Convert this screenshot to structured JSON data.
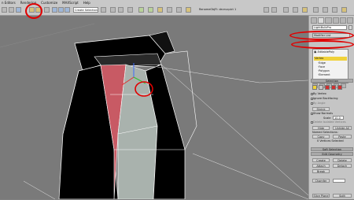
{
  "menu": {
    "items": [
      "n Editors",
      "Rendering",
      "Customize",
      "MAXScript",
      "Help"
    ]
  },
  "toolbar": {
    "selection_set": "Create Selection Set",
    "rename": "RenameObjFi: devrucpict 1"
  },
  "command_panel": {
    "object_name": "LightBulbPro",
    "modifier_list": "Modifier List",
    "stack": {
      "items": [
        {
          "label": "EditablePoly",
          "prefix": "▣-"
        },
        {
          "label": "Vertex",
          "prefix": "·"
        },
        {
          "label": "Edge",
          "prefix": "·"
        },
        {
          "label": "Face",
          "prefix": "·"
        },
        {
          "label": "Polygon",
          "prefix": "·"
        },
        {
          "label": "Element",
          "prefix": "·"
        }
      ]
    },
    "selection": {
      "title": "Selection",
      "by_vertex": "By Vertex",
      "ignore_backfacing": "Ignore Backfacing",
      "by_angle": "By Angle",
      "shrink_grow": "Shrink",
      "show_normals": "Show Normals",
      "scale_label": "Scale",
      "scale_value": "10.0",
      "delete_isolated": "Delete Isolated Vertices",
      "hide": "Hide",
      "unhide_all": "Unhide All",
      "named_selections": "Named Selections:",
      "copy": "Copy",
      "paste": "Paste",
      "status": "0 Vertices Selected"
    },
    "soft_selection": "Soft Selection",
    "edit_geometry": {
      "title": "Edit Geometry",
      "create": "Create",
      "delete": "Delete",
      "attach": "Attach",
      "detach": "Detach",
      "break": "Break",
      "chamfer": "Chamfer",
      "slice_plane": "Slice Plane",
      "split": "Split"
    }
  },
  "colors": {
    "highlight": "#f0d23a",
    "annotation": "#e00000",
    "mesh_wire": "#ffffff",
    "mesh_fill": "#000000",
    "mesh_selected": "#c85a64",
    "mesh_surface": "#a9b2ad"
  },
  "icons": [
    "undo-icon",
    "redo-icon",
    "link-icon",
    "select-object-icon",
    "select-by-name-icon",
    "move-icon",
    "rotate-icon",
    "scale-icon",
    "snap-icon",
    "material-editor-icon",
    "render-icon"
  ]
}
